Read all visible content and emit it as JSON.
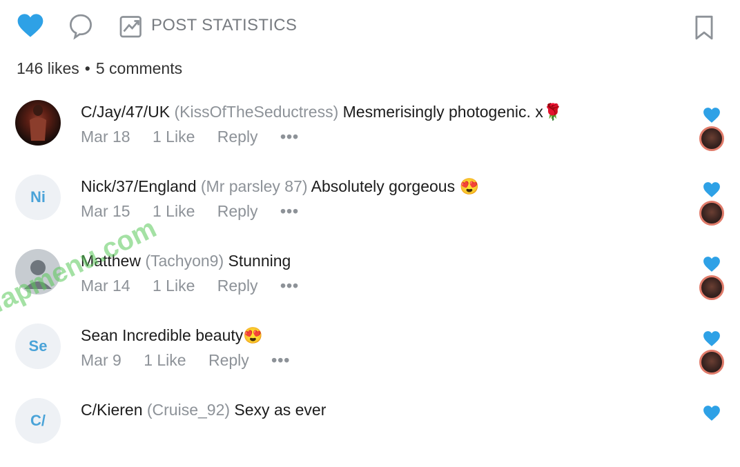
{
  "toolbar": {
    "stats_label": "POST STATISTICS",
    "icons": [
      "heart-icon",
      "comment-icon",
      "stats-icon",
      "bookmark-icon"
    ],
    "accent": "#2ea1e6"
  },
  "summary": {
    "likes": "146 likes",
    "separator": "•",
    "comments": "5 comments"
  },
  "comments": [
    {
      "author": "C/Jay/47/UK",
      "handle": "(KissOfTheSeductress)",
      "text": "Mesmerisingly photogenic. x🌹",
      "date": "Mar 18",
      "likes": "1 Like",
      "reply": "Reply",
      "more": "•••",
      "avatar_initials": ""
    },
    {
      "author": "Nick/37/England",
      "handle": "(Mr parsley 87)",
      "text": "Absolutely gorgeous 😍",
      "date": "Mar 15",
      "likes": "1 Like",
      "reply": "Reply",
      "more": "•••",
      "avatar_initials": "Ni"
    },
    {
      "author": "Matthew",
      "handle": "(Tachyon9)",
      "text": "Stunning",
      "date": "Mar 14",
      "likes": "1 Like",
      "reply": "Reply",
      "more": "•••",
      "avatar_initials": ""
    },
    {
      "author": "Sean",
      "handle": "",
      "text": "Incredible beauty😍",
      "date": "Mar 9",
      "likes": "1 Like",
      "reply": "Reply",
      "more": "•••",
      "avatar_initials": "Se"
    },
    {
      "author": "C/Kieren",
      "handle": "(Cruise_92)",
      "text": "Sexy as ever",
      "date": "",
      "likes": "",
      "reply": "",
      "more": "",
      "avatar_initials": "C/"
    }
  ],
  "watermark": "fapmenu.com"
}
